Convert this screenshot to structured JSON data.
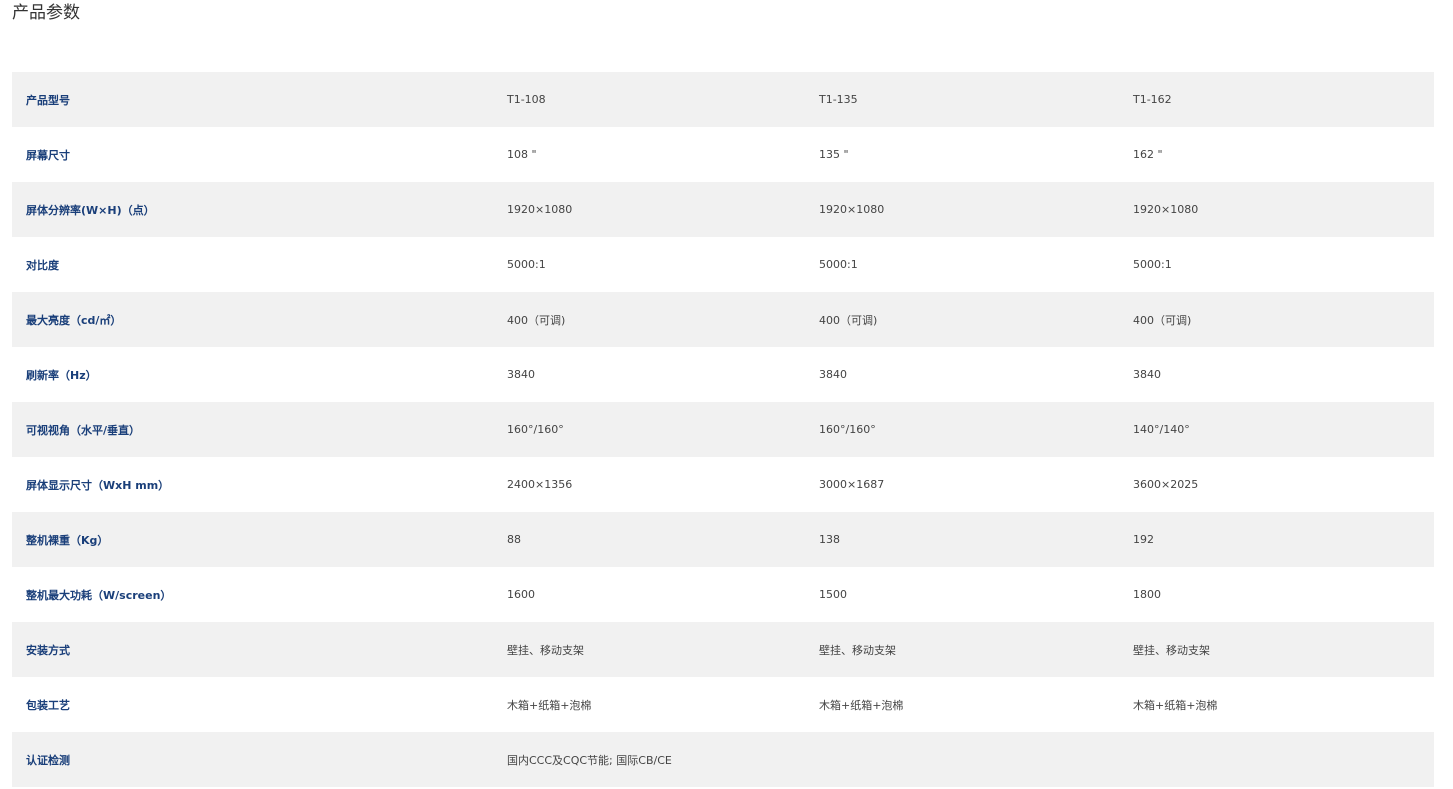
{
  "page": {
    "title": "产品参数"
  },
  "table": {
    "rows": [
      {
        "label": "产品型号",
        "values": [
          "T1-108",
          "T1-135",
          "T1-162"
        ]
      },
      {
        "label": "屏幕尺寸",
        "values": [
          "108 \"",
          "135 \"",
          "162 \""
        ]
      },
      {
        "label": "屏体分辨率(W×H)（点）",
        "values": [
          "1920×1080",
          "1920×1080",
          "1920×1080"
        ]
      },
      {
        "label": "对比度",
        "values": [
          "5000:1",
          "5000:1",
          "5000:1"
        ]
      },
      {
        "label": "最大亮度（cd/㎡）",
        "values": [
          "400（可调)",
          "400（可调)",
          "400（可调)"
        ]
      },
      {
        "label": "刷新率（Hz）",
        "values": [
          "3840",
          "3840",
          "3840"
        ]
      },
      {
        "label": "可视视角（水平/垂直）",
        "values": [
          "160°/160°",
          "160°/160°",
          "140°/140°"
        ]
      },
      {
        "label": "屏体显示尺寸（WxH mm）",
        "values": [
          "2400×1356",
          "3000×1687",
          "3600×2025"
        ]
      },
      {
        "label": "整机裸重（Kg）",
        "values": [
          "88",
          "138",
          "192"
        ]
      },
      {
        "label": "整机最大功耗（W/screen）",
        "values": [
          "1600",
          "1500",
          "1800"
        ]
      },
      {
        "label": "安装方式",
        "values": [
          "壁挂、移动支架",
          "壁挂、移动支架",
          "壁挂、移动支架"
        ]
      },
      {
        "label": "包装工艺",
        "values": [
          "木箱+纸箱+泡棉",
          "木箱+纸箱+泡棉",
          "木箱+纸箱+泡棉"
        ]
      },
      {
        "label": "认证检测",
        "values": [
          "国内CCC及CQC节能; 国际CB/CE",
          "",
          ""
        ]
      }
    ]
  },
  "colors": {
    "label_text": "#1a3f7a",
    "value_text": "#444444",
    "stripe_bg": "#f1f1f1"
  }
}
